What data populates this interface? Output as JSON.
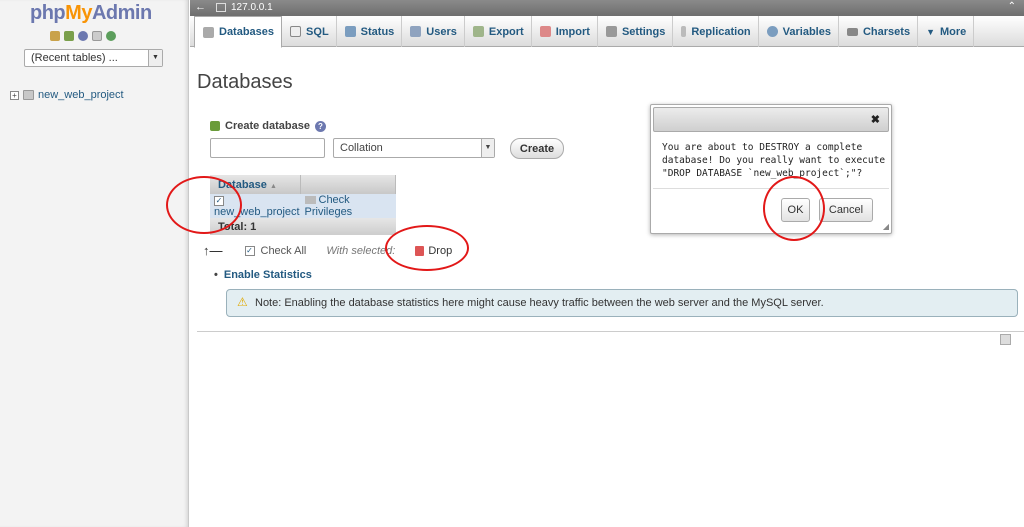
{
  "logo": {
    "part1": "php",
    "part2": "My",
    "part3": "Admin"
  },
  "nav": {
    "recent_tables": "(Recent tables) ...",
    "tree": [
      {
        "label": "new_web_project"
      }
    ]
  },
  "serverbar": {
    "server": "127.0.0.1"
  },
  "tabs": [
    {
      "label": "Databases",
      "active": true
    },
    {
      "label": "SQL"
    },
    {
      "label": "Status"
    },
    {
      "label": "Users"
    },
    {
      "label": "Export"
    },
    {
      "label": "Import"
    },
    {
      "label": "Settings"
    },
    {
      "label": "Replication"
    },
    {
      "label": "Variables"
    },
    {
      "label": "Charsets"
    },
    {
      "label": "More"
    }
  ],
  "main": {
    "title": "Databases",
    "create": {
      "label": "Create database",
      "name_value": "",
      "collation": "Collation",
      "button": "Create"
    },
    "table": {
      "header": "Database",
      "sort_indicator": "▲",
      "rows": [
        {
          "name": "new_web_project",
          "action": "Check Privileges",
          "checked": true
        }
      ],
      "total": "Total: 1"
    },
    "bulk": {
      "check_all": "Check All",
      "with_selected": "With selected:",
      "drop": "Drop"
    },
    "enable_stats": "Enable Statistics",
    "notice": "Note: Enabling the database statistics here might cause heavy traffic between the web server and the MySQL server."
  },
  "dialog": {
    "close": "✖",
    "message": "You are about to DESTROY a complete database! Do you really want to execute \"DROP DATABASE `new_web_project`;\"?",
    "ok": "OK",
    "cancel": "Cancel"
  },
  "colors": {
    "link": "#235a81",
    "annotation": "#e21818",
    "logo_orange": "#f89406",
    "logo_blue": "#6c78af"
  }
}
